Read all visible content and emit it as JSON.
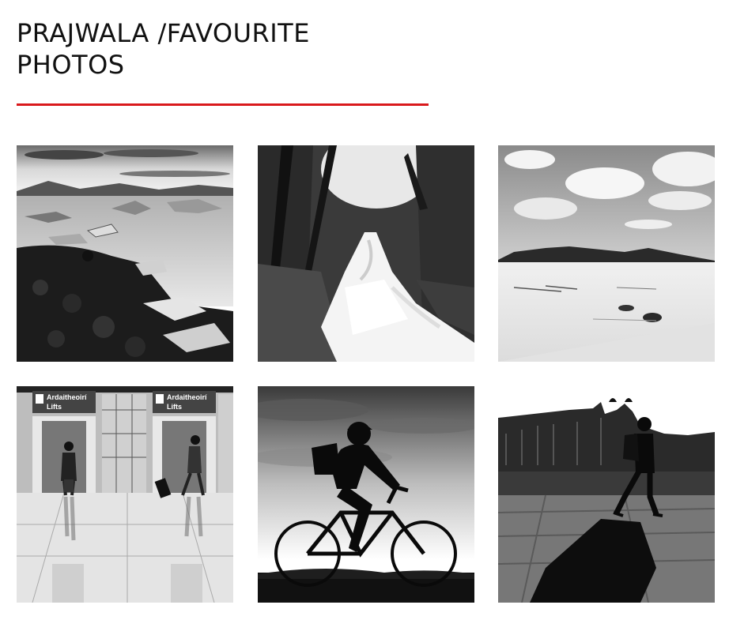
{
  "header": {
    "title_line1": "PRAJWALA /FAVOURITE",
    "title_line2": "PHOTOS",
    "accent_color": "#d9191c"
  },
  "gallery": {
    "photos": [
      {
        "subject": "icebergs-lagoon"
      },
      {
        "subject": "forest-waterfall"
      },
      {
        "subject": "desert-dunes"
      },
      {
        "subject": "airport-lifts",
        "signs": [
          "Ardaitheoirí",
          "Lifts",
          "Ardaitheoirí",
          "Lifts"
        ]
      },
      {
        "subject": "cyclist-silhouette"
      },
      {
        "subject": "walker-silhouette"
      }
    ]
  }
}
